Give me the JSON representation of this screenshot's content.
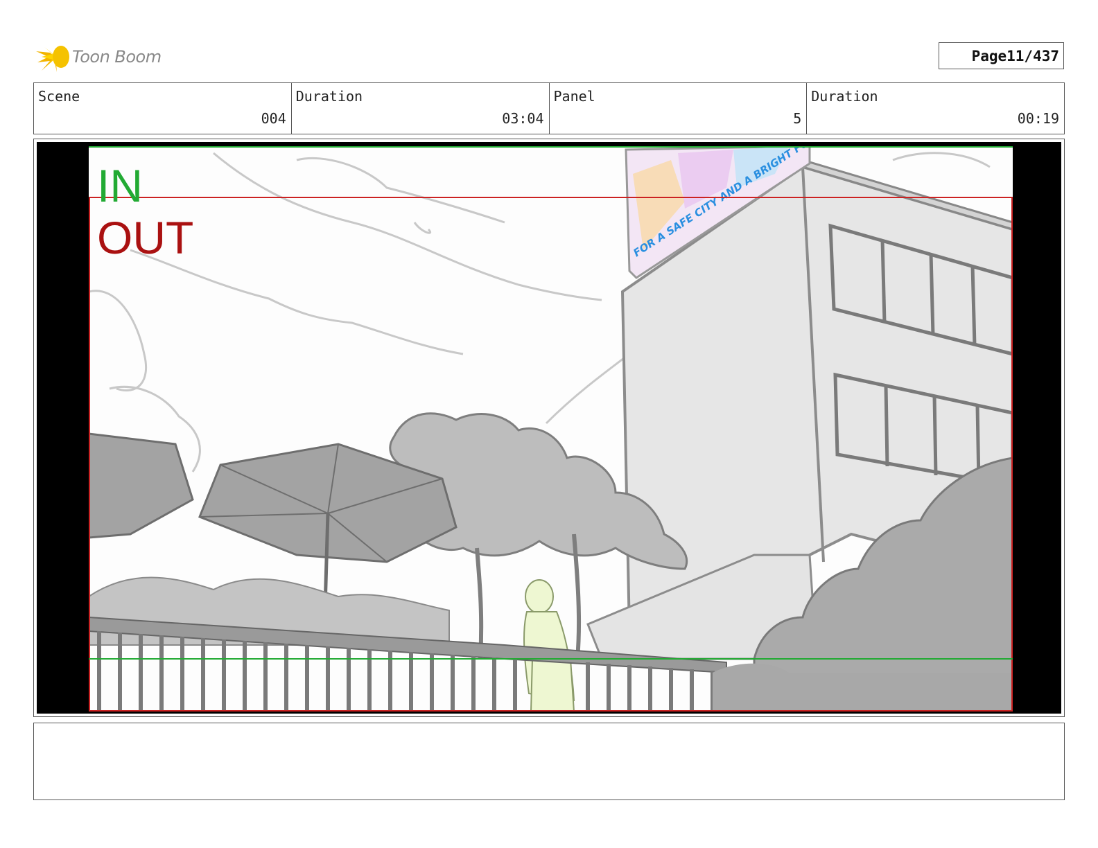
{
  "header": {
    "logo_text": "Toon Boom",
    "page_label": "Page",
    "page_value": "11/437"
  },
  "info": [
    {
      "label": "Scene",
      "value": "004"
    },
    {
      "label": "Duration",
      "value": "03:04"
    },
    {
      "label": "Panel",
      "value": "5"
    },
    {
      "label": "Duration",
      "value": "00:19"
    }
  ],
  "frame": {
    "in_label": "IN",
    "out_label": "OUT",
    "in_color": "#22aa33",
    "out_color": "#aa1111",
    "billboard_text": "FOR A SAFE CITY AND A BRIGHT FUTURE"
  },
  "notes": {
    "text": ""
  }
}
